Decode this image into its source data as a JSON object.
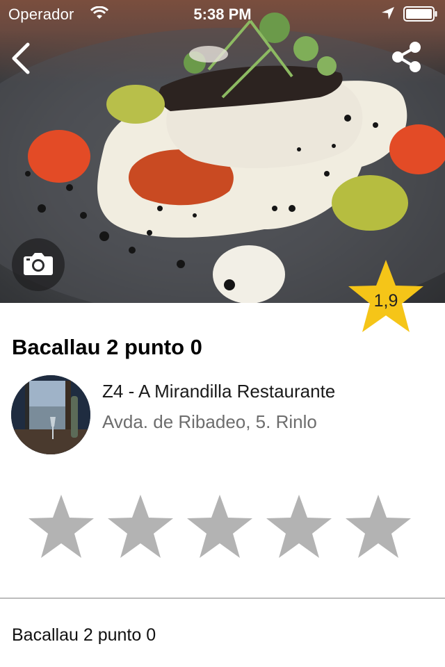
{
  "status_bar": {
    "carrier": "Operador",
    "time": "5:38 PM",
    "icons": [
      "wifi-icon",
      "location-arrow-icon",
      "battery-icon"
    ]
  },
  "header": {
    "back_icon": "chevron-left-icon",
    "share_icon": "share-icon",
    "camera_icon": "camera-icon"
  },
  "dish": {
    "name": "Bacallau 2 punto 0",
    "rating": "1,9",
    "description": "Bacallau 2 punto 0"
  },
  "restaurant": {
    "name": "Z4 - A Mirandilla Restaurante",
    "address": "Avda. de Ribadeo, 5. Rinlo"
  },
  "user_rating": {
    "max": 5,
    "value": 0
  },
  "colors": {
    "badge_star": "#f5c518",
    "empty_star": "#b3b3b3",
    "divider": "#bdbdbd",
    "address_text": "#6d6d6d"
  }
}
